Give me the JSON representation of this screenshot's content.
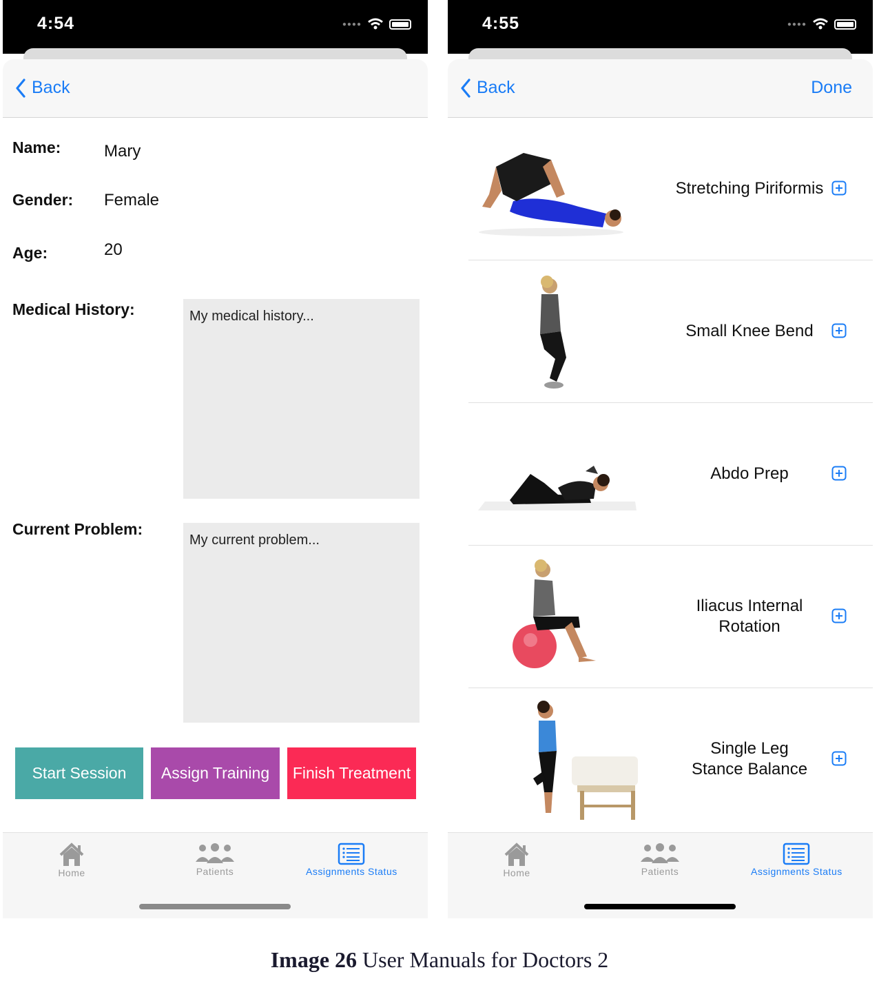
{
  "left_screen": {
    "status_time": "4:54",
    "nav": {
      "back_label": "Back"
    },
    "fields": {
      "name_label": "Name:",
      "name_value": "Mary",
      "gender_label": "Gender:",
      "gender_value": "Female",
      "age_label": "Age:",
      "age_value": "20",
      "medical_history_label": "Medical History:",
      "medical_history_value": "My medical history...",
      "current_problem_label": "Current Problem:",
      "current_problem_value": "My current problem..."
    },
    "buttons": {
      "start_session": "Start Session",
      "assign_training": "Assign Training",
      "finish_treatment": "Finish Treatment"
    },
    "colors": {
      "start": "#4aa9a6",
      "assign": "#a94aaa",
      "finish": "#fb2a55",
      "accent": "#1a7cf6"
    }
  },
  "right_screen": {
    "status_time": "4:55",
    "nav": {
      "back_label": "Back",
      "done_label": "Done"
    },
    "exercises": [
      {
        "title": "Stretching Piriformis",
        "icon": "plus-square-icon"
      },
      {
        "title": "Small Knee Bend",
        "icon": "plus-square-icon"
      },
      {
        "title": "Abdo Prep",
        "icon": "plus-square-icon"
      },
      {
        "title": "Iliacus Internal\nRotation",
        "icon": "plus-square-icon"
      },
      {
        "title": "Single Leg\nStance Balance",
        "icon": "plus-square-icon"
      }
    ]
  },
  "tabbar": {
    "home": "Home",
    "patients": "Patients",
    "assignments_status": "Assignments Status"
  },
  "caption": {
    "bold": "Image 26",
    "text": " User Manuals for Doctors 2"
  }
}
